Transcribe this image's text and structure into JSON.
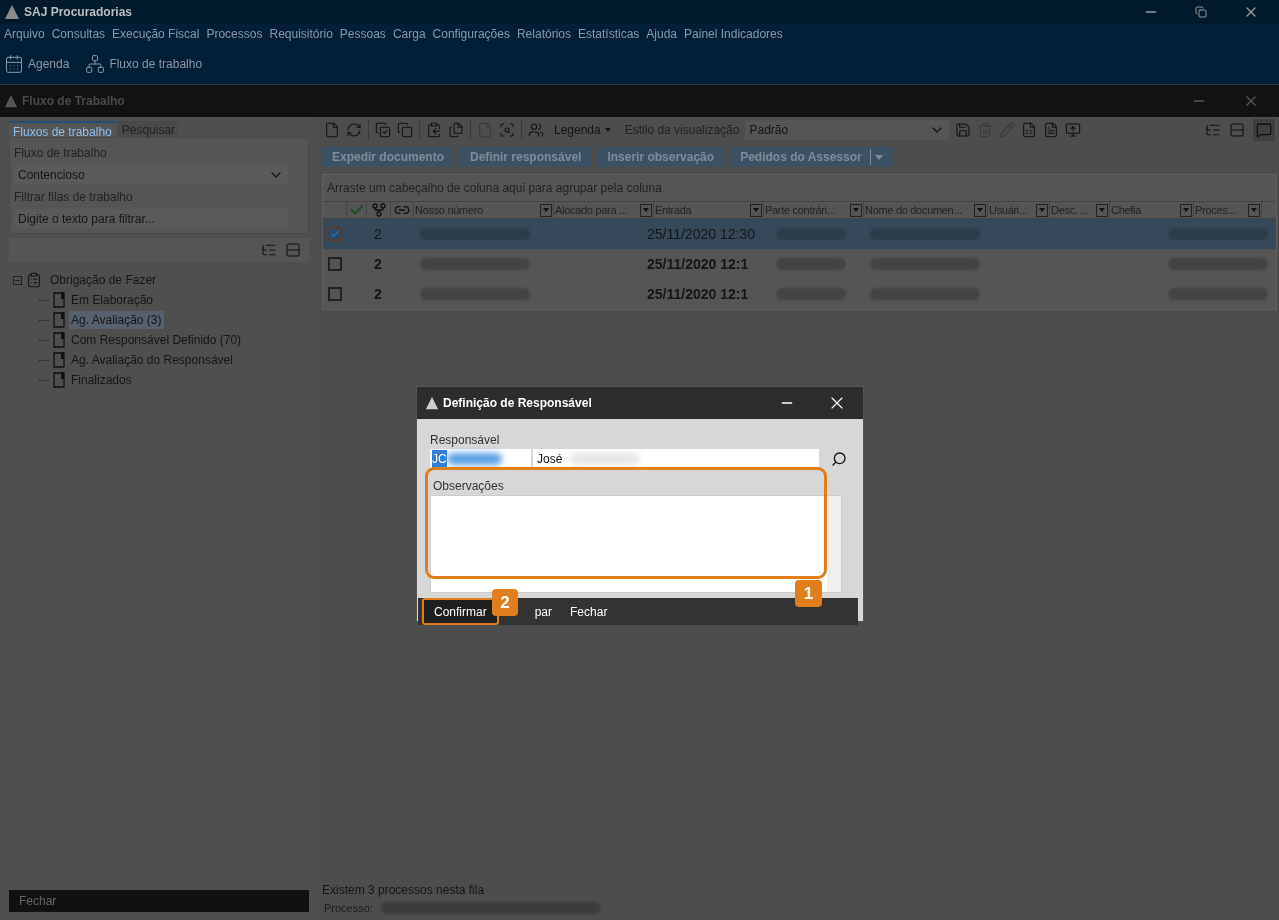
{
  "app": {
    "title": "SAJ Procuradorias"
  },
  "menu": [
    "Arquivo",
    "Consultas",
    "Execução Fiscal",
    "Processos",
    "Requisitório",
    "Pessoas",
    "Carga",
    "Configurações",
    "Relatórios",
    "Estatísticas",
    "Ajuda",
    "Painel Indicadores"
  ],
  "toolbar": [
    {
      "label": "Agenda",
      "kind": "calendar"
    },
    {
      "label": "Fluxo de trabalho",
      "kind": "flow"
    }
  ],
  "window": {
    "title": "Fluxo de Trabalho"
  },
  "left_panel": {
    "tabs": [
      {
        "label": "Fluxos de trabalho",
        "selected": true
      },
      {
        "label": "Pesquisar",
        "selected": false
      }
    ],
    "flow_label": "Fluxo de trabalho",
    "flow_value": "Contencioso",
    "filter_label": "Filtrar filas de trabalho",
    "filter_placeholder": "Digite o texto para filtrar...",
    "tree": [
      {
        "label": "Obrigação de Fazer",
        "expanded": true,
        "children": [
          {
            "label": "Em Elaboração",
            "selected": false
          },
          {
            "label": "Ag. Avaliação (3)",
            "selected": true
          },
          {
            "label": "Com Responsável Definido (70)",
            "selected": false
          },
          {
            "label": "Ag. Avaliação do Responsável",
            "selected": false
          },
          {
            "label": "Finalizados",
            "selected": false
          }
        ]
      }
    ],
    "close_button": "Fechar"
  },
  "grid": {
    "legend": "Legenda",
    "view_style_label": "Estilo da visualização",
    "view_style_value": "Padrão",
    "actions": [
      "Expedir documento",
      "Definir responsável",
      "Inserir observação",
      "Pedidos do Assessor"
    ],
    "group_hint": "Arraste um cabeçalho de coluna aqui para agrupar pela coluna",
    "columns": [
      "Nosso número",
      "Alocado para ...",
      "Entrada",
      "Parte contrári...",
      "Nome do documen...",
      "Usuári...",
      "Desc. ...",
      "Chefia",
      "Proces..."
    ],
    "rows": [
      {
        "checked": true,
        "selected": true,
        "unread": false,
        "count": "2",
        "entry": "25/11/2020 12:30"
      },
      {
        "checked": false,
        "selected": false,
        "unread": true,
        "count": "2",
        "entry": "25/11/2020 12:1"
      },
      {
        "checked": false,
        "selected": false,
        "unread": true,
        "count": "2",
        "entry": "25/11/2020 12:1"
      }
    ],
    "status": "Existem 3 processos nesta fila",
    "process_label": "Processo:"
  },
  "dialog": {
    "title": "Definição de Responsável",
    "responsible_label": "Responsável",
    "code_value": "JC",
    "name_value": "José",
    "notes_label": "Observações",
    "buttons": [
      {
        "label": "Confirmar",
        "selected": true
      },
      {
        "label": "par",
        "selected": false
      },
      {
        "label": "Fechar",
        "selected": false
      }
    ],
    "callouts": [
      "1",
      "2"
    ]
  }
}
